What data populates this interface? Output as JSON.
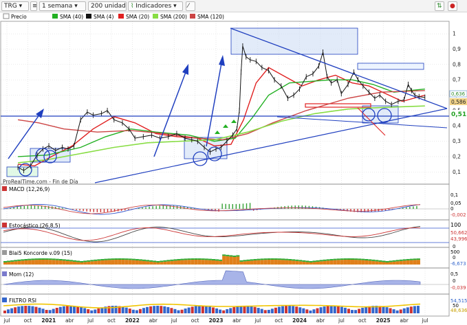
{
  "toolbar": {
    "symbol": "TRG",
    "period": "1 semana",
    "units": "200 unidades",
    "indicators_label": "Indicadores",
    "icons": [
      "dropdown-arrow-icon",
      "trend-arrow-icon"
    ]
  },
  "legend": {
    "price": "Precio",
    "sma40": "SMA (40)",
    "sma4": "SMA (4)",
    "sma20": "SMA (20)",
    "sma200": "SMA (200)",
    "sma120": "SMA (120)"
  },
  "watermark": "ProRealTime.com - Fin de Día",
  "colors": {
    "price": "#111111",
    "sma40": "#22b022",
    "sma4": "#111111",
    "sma20": "#e02020",
    "sma200": "#88dd44",
    "sma120": "#cc4444",
    "annotation_blue": "#1f3fbf",
    "highlight_label": "#f2d48a",
    "last_price_label": "#444444"
  },
  "x_axis_labels": [
    "jul",
    "oct",
    "2021",
    "abr",
    "jul",
    "oct",
    "2022",
    "abr",
    "jul",
    "oct",
    "2023",
    "abr",
    "jul",
    "oct",
    "2024",
    "abr",
    "jul",
    "oct",
    "2025",
    "abr",
    "jul"
  ],
  "chart_data": [
    {
      "type": "line",
      "title": "TRG",
      "y_ticks": [
        1,
        0.9,
        0.8,
        0.7,
        0.6,
        0.5,
        0.4,
        0.3,
        0.2,
        0.1
      ],
      "y_tick_labels": [
        "1",
        "0,9",
        "0,8",
        "0,7",
        "0,6",
        "0,5",
        "0,4",
        "0,3",
        "0,2",
        "0,1"
      ],
      "ylim": [
        0.07,
        1.07
      ],
      "labels": [
        "0,636",
        "0,586",
        "0,51"
      ],
      "series": [
        {
          "name": "Precio",
          "values": [
            [
              2020.55,
              0.13
            ],
            [
              2020.62,
              0.11
            ],
            [
              2020.7,
              0.14
            ],
            [
              2020.78,
              0.21
            ],
            [
              2020.85,
              0.25
            ],
            [
              2020.92,
              0.27
            ],
            [
              2021.0,
              0.24
            ],
            [
              2021.08,
              0.26
            ],
            [
              2021.15,
              0.25
            ],
            [
              2021.22,
              0.27
            ],
            [
              2021.3,
              0.44
            ],
            [
              2021.38,
              0.49
            ],
            [
              2021.45,
              0.47
            ],
            [
              2021.55,
              0.48
            ],
            [
              2021.62,
              0.5
            ],
            [
              2021.7,
              0.44
            ],
            [
              2021.8,
              0.42
            ],
            [
              2021.88,
              0.38
            ],
            [
              2021.95,
              0.32
            ],
            [
              2022.05,
              0.33
            ],
            [
              2022.15,
              0.34
            ],
            [
              2022.25,
              0.32
            ],
            [
              2022.35,
              0.33
            ],
            [
              2022.45,
              0.35
            ],
            [
              2022.55,
              0.32
            ],
            [
              2022.63,
              0.31
            ],
            [
              2022.7,
              0.3
            ],
            [
              2022.78,
              0.26
            ],
            [
              2022.85,
              0.23
            ],
            [
              2022.92,
              0.25
            ],
            [
              2022.98,
              0.26
            ],
            [
              2023.05,
              0.3
            ],
            [
              2023.12,
              0.34
            ],
            [
              2023.17,
              0.38
            ],
            [
              2023.2,
              0.5
            ],
            [
              2023.22,
              0.75
            ],
            [
              2023.24,
              0.92
            ],
            [
              2023.28,
              0.85
            ],
            [
              2023.33,
              0.83
            ],
            [
              2023.4,
              0.82
            ],
            [
              2023.47,
              0.78
            ],
            [
              2023.55,
              0.76
            ],
            [
              2023.62,
              0.7
            ],
            [
              2023.7,
              0.66
            ],
            [
              2023.78,
              0.58
            ],
            [
              2023.85,
              0.6
            ],
            [
              2023.92,
              0.64
            ],
            [
              2024.0,
              0.72
            ],
            [
              2024.08,
              0.74
            ],
            [
              2024.15,
              0.79
            ],
            [
              2024.2,
              0.88
            ],
            [
              2024.25,
              0.72
            ],
            [
              2024.3,
              0.68
            ],
            [
              2024.37,
              0.7
            ],
            [
              2024.42,
              0.61
            ],
            [
              2024.5,
              0.67
            ],
            [
              2024.57,
              0.75
            ],
            [
              2024.62,
              0.7
            ],
            [
              2024.68,
              0.66
            ],
            [
              2024.75,
              0.62
            ],
            [
              2024.82,
              0.58
            ],
            [
              2024.88,
              0.6
            ],
            [
              2024.95,
              0.56
            ],
            [
              2025.02,
              0.54
            ],
            [
              2025.1,
              0.56
            ],
            [
              2025.17,
              0.57
            ],
            [
              2025.22,
              0.67
            ],
            [
              2025.26,
              0.63
            ],
            [
              2025.3,
              0.6
            ],
            [
              2025.35,
              0.59
            ],
            [
              2025.42,
              0.586
            ]
          ]
        },
        {
          "name": "SMA (20)",
          "values": [
            [
              2020.55,
              0.15
            ],
            [
              2020.75,
              0.14
            ],
            [
              2020.95,
              0.2
            ],
            [
              2021.2,
              0.27
            ],
            [
              2021.45,
              0.38
            ],
            [
              2021.7,
              0.46
            ],
            [
              2021.95,
              0.42
            ],
            [
              2022.2,
              0.35
            ],
            [
              2022.45,
              0.33
            ],
            [
              2022.7,
              0.32
            ],
            [
              2022.9,
              0.27
            ],
            [
              2023.1,
              0.28
            ],
            [
              2023.25,
              0.44
            ],
            [
              2023.4,
              0.68
            ],
            [
              2023.55,
              0.78
            ],
            [
              2023.75,
              0.72
            ],
            [
              2023.95,
              0.66
            ],
            [
              2024.15,
              0.7
            ],
            [
              2024.35,
              0.73
            ],
            [
              2024.55,
              0.68
            ],
            [
              2024.75,
              0.66
            ],
            [
              2024.95,
              0.61
            ],
            [
              2025.15,
              0.56
            ],
            [
              2025.42,
              0.6
            ]
          ]
        },
        {
          "name": "SMA (40)",
          "values": [
            [
              2020.55,
              0.2
            ],
            [
              2020.9,
              0.21
            ],
            [
              2021.3,
              0.26
            ],
            [
              2021.6,
              0.33
            ],
            [
              2021.9,
              0.38
            ],
            [
              2022.2,
              0.36
            ],
            [
              2022.6,
              0.34
            ],
            [
              2022.9,
              0.3
            ],
            [
              2023.15,
              0.32
            ],
            [
              2023.35,
              0.45
            ],
            [
              2023.55,
              0.6
            ],
            [
              2023.8,
              0.68
            ],
            [
              2024.05,
              0.69
            ],
            [
              2024.3,
              0.7
            ],
            [
              2024.55,
              0.7
            ],
            [
              2024.8,
              0.67
            ],
            [
              2025.05,
              0.62
            ],
            [
              2025.42,
              0.64
            ]
          ]
        },
        {
          "name": "SMA (120)",
          "values": [
            [
              2020.55,
              0.44
            ],
            [
              2020.8,
              0.42
            ],
            [
              2021.1,
              0.38
            ],
            [
              2021.5,
              0.36
            ],
            [
              2021.9,
              0.37
            ],
            [
              2022.3,
              0.35
            ],
            [
              2022.7,
              0.32
            ],
            [
              2023.0,
              0.31
            ],
            [
              2023.3,
              0.35
            ],
            [
              2023.6,
              0.42
            ],
            [
              2024.0,
              0.5
            ],
            [
              2024.5,
              0.58
            ],
            [
              2024.9,
              0.62
            ],
            [
              2025.42,
              0.63
            ]
          ]
        },
        {
          "name": "SMA (200)",
          "values": [
            [
              2020.55,
              0.16
            ],
            [
              2020.9,
              0.18
            ],
            [
              2021.3,
              0.22
            ],
            [
              2021.7,
              0.26
            ],
            [
              2022.1,
              0.29
            ],
            [
              2022.5,
              0.3
            ],
            [
              2022.9,
              0.31
            ],
            [
              2023.3,
              0.36
            ],
            [
              2023.7,
              0.43
            ],
            [
              2024.1,
              0.48
            ],
            [
              2024.5,
              0.51
            ],
            [
              2024.9,
              0.52
            ],
            [
              2025.42,
              0.53
            ]
          ]
        }
      ]
    },
    {
      "type": "line",
      "title": "MACD (12,26,9)",
      "labels": [
        "0,1",
        "0,05",
        "0",
        "-0,002"
      ]
    },
    {
      "type": "line",
      "title": "Estocástico (26,8,5)",
      "labels": [
        "100",
        "50,662",
        "43,996",
        "0"
      ]
    },
    {
      "type": "area",
      "title": "Blai5 Koncorde v.09 (15)",
      "labels": [
        "500",
        "0",
        "-6,673"
      ]
    },
    {
      "type": "line",
      "title": "Mom (12)",
      "labels": [
        "0,5",
        "0",
        "-0,039"
      ]
    },
    {
      "type": "line",
      "title": "FILTRO RSI",
      "labels": [
        "54,515",
        "50",
        "48,636"
      ]
    }
  ]
}
